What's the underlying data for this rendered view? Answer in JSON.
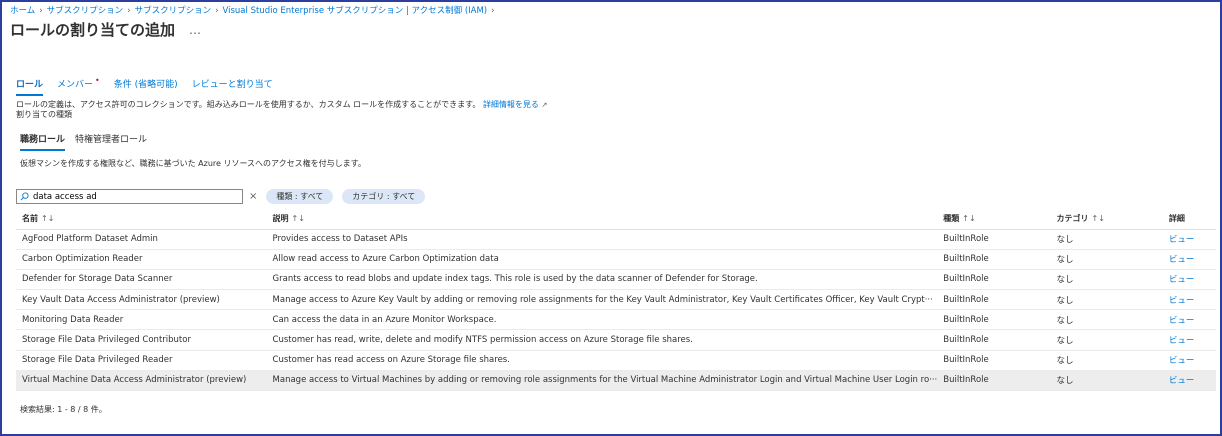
{
  "breadcrumb": {
    "items": [
      "ホーム",
      "サブスクリプション",
      "サブスクリプション",
      "Visual Studio Enterprise サブスクリプション | アクセス制御 (IAM)"
    ],
    "separator": "›"
  },
  "page": {
    "title": "ロールの割り当ての追加",
    "more": "…"
  },
  "tabs": [
    {
      "label": "ロール",
      "active": true
    },
    {
      "label": "メンバー",
      "required": "•"
    },
    {
      "label": "条件 (省略可能)"
    },
    {
      "label": "レビューと割り当て"
    }
  ],
  "description": {
    "line1": "ロールの定義は、アクセス許可のコレクションです。組み込みロールを使用するか、カスタム ロールを作成することができます。",
    "link": "詳細情報を見る",
    "line2": "割り当ての種類"
  },
  "subtabs": [
    {
      "label": "職務ロール",
      "active": true
    },
    {
      "label": "特権管理者ロール"
    }
  ],
  "subdesc": "仮想マシンを作成する権限など、職務に基づいた Azure リソースへのアクセス権を付与します。",
  "search": {
    "value": "data access ad",
    "clear": "×"
  },
  "filters": [
    "種類 : すべて",
    "カテゴリ : すべて"
  ],
  "table": {
    "headers": {
      "name": "名前",
      "desc": "説明",
      "type": "種類",
      "category": "カテゴリ",
      "detail": "詳細"
    },
    "sort_icon": "↑↓",
    "rows": [
      {
        "name": "AgFood Platform Dataset Admin",
        "desc": "Provides access to Dataset APIs",
        "type": "BuiltInRole",
        "category": "なし",
        "view": "ビュー"
      },
      {
        "name": "Carbon Optimization Reader",
        "desc": "Allow read access to Azure Carbon Optimization data",
        "type": "BuiltInRole",
        "category": "なし",
        "view": "ビュー"
      },
      {
        "name": "Defender for Storage Data Scanner",
        "desc": "Grants access to read blobs and update index tags. This role is used by the data scanner of Defender for Storage.",
        "type": "BuiltInRole",
        "category": "なし",
        "view": "ビュー"
      },
      {
        "name": "Key Vault Data Access Administrator (preview)",
        "desc": "Manage access to Azure Key Vault by adding or removing role assignments for the Key Vault Administrator, Key Vault Certificates Officer, Key Vault Crypt···",
        "type": "BuiltInRole",
        "category": "なし",
        "view": "ビュー"
      },
      {
        "name": "Monitoring Data Reader",
        "desc": "Can access the data in an Azure Monitor Workspace.",
        "type": "BuiltInRole",
        "category": "なし",
        "view": "ビュー"
      },
      {
        "name": "Storage File Data Privileged Contributor",
        "desc": "Customer has read, write, delete and modify NTFS permission access on Azure Storage file shares.",
        "type": "BuiltInRole",
        "category": "なし",
        "view": "ビュー"
      },
      {
        "name": "Storage File Data Privileged Reader",
        "desc": "Customer has read access on Azure Storage file shares.",
        "type": "BuiltInRole",
        "category": "なし",
        "view": "ビュー"
      },
      {
        "name": "Virtual Machine Data Access Administrator (preview)",
        "desc": "Manage access to Virtual Machines by adding or removing role assignments for the Virtual Machine Administrator Login and Virtual Machine User Login ro···",
        "type": "BuiltInRole",
        "category": "なし",
        "view": "ビュー",
        "selected": true
      }
    ]
  },
  "footer": "検索結果: 1 - 8 / 8 件。",
  "colors": {
    "accent": "#0078d4",
    "frame": "#2c3e9e",
    "pill": "#dbe7f6",
    "selected_row": "#ededed"
  }
}
